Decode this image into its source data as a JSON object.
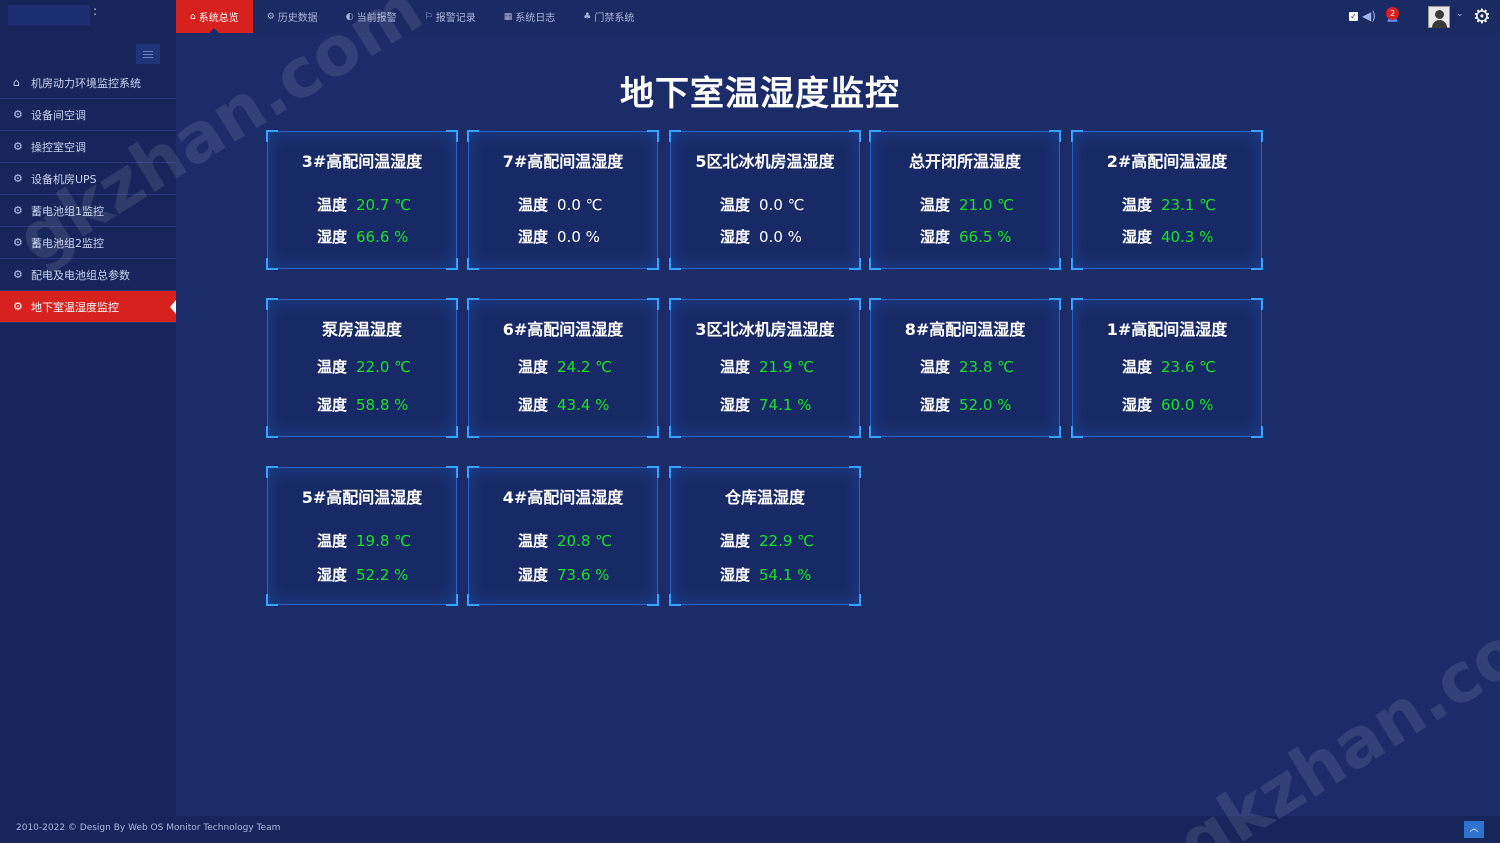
{
  "topbar": {
    "nav": [
      {
        "label": "系统总览",
        "icon": "home-icon",
        "glyph": "⌂",
        "active": true
      },
      {
        "label": "历史数据",
        "icon": "cogs-icon",
        "glyph": "⚙",
        "active": false
      },
      {
        "label": "当前报警",
        "icon": "adjust-icon",
        "glyph": "◐",
        "active": false
      },
      {
        "label": "报警记录",
        "icon": "bookmark-icon",
        "glyph": "⚐",
        "active": false
      },
      {
        "label": "系统日志",
        "icon": "table-icon",
        "glyph": "▦",
        "active": false
      },
      {
        "label": "门禁系统",
        "icon": "sitemap-icon",
        "glyph": "♣",
        "active": false
      }
    ],
    "alarm_count": "2"
  },
  "sidebar": {
    "items": [
      {
        "label": "机房动力环境监控系统",
        "icon": "home-icon",
        "glyph": "⌂",
        "active": false
      },
      {
        "label": "设备间空调",
        "icon": "cogs-icon",
        "glyph": "⚙",
        "active": false
      },
      {
        "label": "操控室空调",
        "icon": "cogs-icon",
        "glyph": "⚙",
        "active": false
      },
      {
        "label": "设备机房UPS",
        "icon": "cogs-icon",
        "glyph": "⚙",
        "active": false
      },
      {
        "label": "蓄电池组1监控",
        "icon": "cogs-icon",
        "glyph": "⚙",
        "active": false
      },
      {
        "label": "蓄电池组2监控",
        "icon": "cogs-icon",
        "glyph": "⚙",
        "active": false
      },
      {
        "label": "配电及电池组总参数",
        "icon": "cogs-icon",
        "glyph": "⚙",
        "active": false
      },
      {
        "label": "地下室温湿度监控",
        "icon": "cogs-icon",
        "glyph": "⚙",
        "active": true
      }
    ]
  },
  "main": {
    "title": "地下室温湿度监控",
    "temp_label": "温度",
    "hum_label": "湿度",
    "cards": [
      {
        "title": "3#高配间温湿度",
        "temp": "20.7 ℃",
        "hum": "66.6 %",
        "ok": true
      },
      {
        "title": "7#高配间温湿度",
        "temp": "0.0 ℃",
        "hum": "0.0 %",
        "ok": false
      },
      {
        "title": "5区北冰机房温湿度",
        "temp": "0.0 ℃",
        "hum": "0.0 %",
        "ok": false
      },
      {
        "title": "总开闭所温湿度",
        "temp": "21.0 ℃",
        "hum": "66.5 %",
        "ok": true
      },
      {
        "title": "2#高配间温湿度",
        "temp": "23.1 ℃",
        "hum": "40.3 %",
        "ok": true
      },
      {
        "title": "泵房温湿度",
        "temp": "22.0 ℃",
        "hum": "58.8 %",
        "ok": true
      },
      {
        "title": "6#高配间温湿度",
        "temp": "24.2 ℃",
        "hum": "43.4 %",
        "ok": true
      },
      {
        "title": "3区北冰机房温湿度",
        "temp": "21.9 ℃",
        "hum": "74.1 %",
        "ok": true
      },
      {
        "title": "8#高配间温湿度",
        "temp": "23.8 ℃",
        "hum": "52.0 %",
        "ok": true
      },
      {
        "title": "1#高配间温湿度",
        "temp": "23.6 ℃",
        "hum": "60.0 %",
        "ok": true
      },
      {
        "title": "5#高配间温湿度",
        "temp": "19.8 ℃",
        "hum": "52.2 %",
        "ok": true
      },
      {
        "title": "4#高配间温湿度",
        "temp": "20.8 ℃",
        "hum": "73.6 %",
        "ok": true
      },
      {
        "title": "仓库温湿度",
        "temp": "22.9 ℃",
        "hum": "54.1 %",
        "ok": true
      }
    ]
  },
  "footer": {
    "text": "2010-2022 © Design By Web OS Monitor Technology Team"
  },
  "watermark": {
    "text": "gkzhan.com"
  },
  "colors": {
    "accent_red": "#d7211e",
    "ok_green": "#19e028",
    "card_border": "#35a3ff",
    "background": "#1b2c68"
  }
}
